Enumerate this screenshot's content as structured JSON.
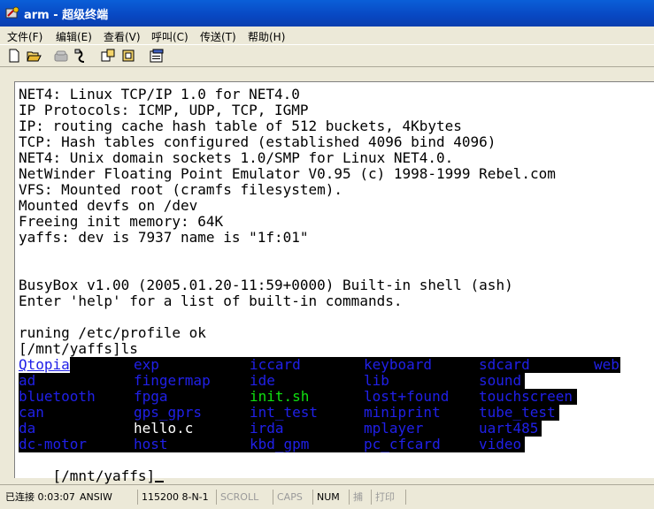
{
  "window": {
    "title": "arm - 超级终端"
  },
  "menu": [
    {
      "label": "文件(F)"
    },
    {
      "label": "编辑(E)"
    },
    {
      "label": "查看(V)"
    },
    {
      "label": "呼叫(C)"
    },
    {
      "label": "传送(T)"
    },
    {
      "label": "帮助(H)"
    }
  ],
  "toolbar": {
    "icons": [
      "new-icon",
      "open-icon",
      "call-icon",
      "disconnect-icon",
      "send-icon",
      "receive-icon",
      "properties-icon"
    ]
  },
  "terminal": {
    "lines": [
      "NET4: Linux TCP/IP 1.0 for NET4.0",
      "IP Protocols: ICMP, UDP, TCP, IGMP",
      "IP: routing cache hash table of 512 buckets, 4Kbytes",
      "TCP: Hash tables configured (established 4096 bind 4096)",
      "NET4: Unix domain sockets 1.0/SMP for Linux NET4.0.",
      "NetWinder Floating Point Emulator V0.95 (c) 1998-1999 Rebel.com",
      "VFS: Mounted root (cramfs filesystem).",
      "Mounted devfs on /dev",
      "Freeing init memory: 64K",
      "yaffs: dev is 7937 name is \"1f:01\"",
      "",
      "",
      "BusyBox v1.00 (2005.01.20-11:59+0000) Built-in shell (ash)",
      "Enter 'help' for a list of built-in commands.",
      "",
      "runing /etc/profile ok",
      "[/mnt/yaffs]ls"
    ],
    "listing": [
      [
        "Qtopia",
        "exp",
        "iccard",
        "keyboard",
        "sdcard",
        "web"
      ],
      [
        "ad",
        "fingermap",
        "ide",
        "lib",
        "sound",
        ""
      ],
      [
        "bluetooth",
        "fpga",
        "init.sh",
        "lost+found",
        "touchscreen",
        ""
      ],
      [
        "can",
        "gps_gprs",
        "int_test",
        "miniprint",
        "tube_test",
        ""
      ],
      [
        "da",
        "hello.c",
        "irda",
        "mplayer",
        "uart485",
        ""
      ],
      [
        "dc-motor",
        "host",
        "kbd_gpm",
        "pc_cfcard",
        "video",
        ""
      ]
    ],
    "prompt": "[/mnt/yaffs]",
    "colors": {
      "directory": "#2020e8",
      "executable": "#10e010",
      "file": "#ffffff",
      "background": "#000000"
    }
  },
  "status": {
    "connection": "已连接 0:03:07",
    "emulation": "ANSIW",
    "settings": "115200 8-N-1",
    "scroll": "SCROLL",
    "caps": "CAPS",
    "num": "NUM",
    "capture": "捕",
    "print": "打印"
  }
}
